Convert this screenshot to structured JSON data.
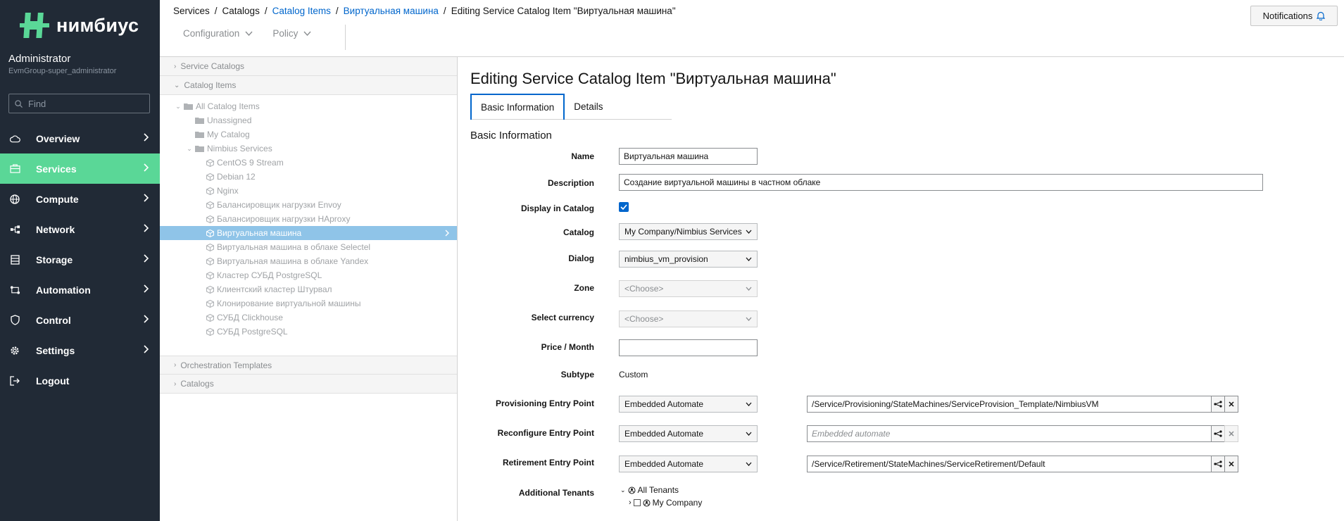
{
  "app": {
    "name": "нимбиус",
    "brand_color": "#5ad797",
    "sidebar_bg": "#212a36",
    "link_color": "#0066cc"
  },
  "user": {
    "name": "Administrator",
    "group": "EvmGroup-super_administrator"
  },
  "search": {
    "placeholder": "Find"
  },
  "nav": [
    {
      "label": "Overview",
      "icon": "cloud-icon",
      "active": false
    },
    {
      "label": "Services",
      "icon": "box-icon",
      "active": true
    },
    {
      "label": "Compute",
      "icon": "globe-icon",
      "active": false
    },
    {
      "label": "Network",
      "icon": "network-icon",
      "active": false
    },
    {
      "label": "Storage",
      "icon": "database-icon",
      "active": false
    },
    {
      "label": "Automation",
      "icon": "automation-icon",
      "active": false
    },
    {
      "label": "Control",
      "icon": "shield-icon",
      "active": false
    },
    {
      "label": "Settings",
      "icon": "gear-icon",
      "active": false
    },
    {
      "label": "Logout",
      "icon": "logout-icon",
      "active": false
    }
  ],
  "breadcrumb": {
    "items": [
      "Services",
      "Catalogs",
      "Catalog Items",
      "Виртуальная машина",
      "Editing Service Catalog Item \"Виртуальная машина\""
    ],
    "separator": "/"
  },
  "toolbar": {
    "configuration": "Configuration",
    "policy": "Policy"
  },
  "notifications": {
    "label": "Notifications"
  },
  "accordion": {
    "service_catalogs": "Service Catalogs",
    "catalog_items": "Catalog Items",
    "orchestration_templates": "Orchestration Templates",
    "catalogs": "Catalogs"
  },
  "tree": {
    "root": "All Catalog Items",
    "unassigned": "Unassigned",
    "my_catalog": "My Catalog",
    "nimbius_services": "Nimbius Services",
    "items": [
      "CentOS 9 Stream",
      "Debian 12",
      "Nginx",
      "Балансировщик нагрузки Envoy",
      "Балансировщик нагрузки HAproxy",
      "Виртуальная машина",
      "Виртуальная машина в облаке Selectel",
      "Виртуальная машина в облаке Yandex",
      "Кластер СУБД PostgreSQL",
      "Клиентский кластер Штурвал",
      "Клонирование виртуальной машины",
      "СУБД Clickhouse",
      "СУБД PostgreSQL"
    ],
    "selected_index": 5
  },
  "form": {
    "title": "Editing Service Catalog Item \"Виртуальная машина\"",
    "tabs": [
      "Basic Information",
      "Details"
    ],
    "section": "Basic Information",
    "labels": {
      "name": "Name",
      "description": "Description",
      "display_in_catalog": "Display in Catalog",
      "catalog": "Catalog",
      "dialog": "Dialog",
      "zone": "Zone",
      "currency": "Select currency",
      "price": "Price / Month",
      "subtype": "Subtype",
      "provisioning": "Provisioning Entry Point",
      "reconfigure": "Reconfigure Entry Point",
      "retirement": "Retirement Entry Point",
      "tenants": "Additional Tenants"
    },
    "values": {
      "name": "Виртуальная машина",
      "description": "Создание виртуальной машины в частном облаке",
      "display_in_catalog": true,
      "catalog": "My Company/Nimbius Services",
      "dialog": "nimbius_vm_provision",
      "zone": "<Choose>",
      "currency": "<Choose>",
      "price": "",
      "subtype": "Custom",
      "provisioning_type": "Embedded Automate",
      "provisioning_path": "/Service/Provisioning/StateMachines/ServiceProvision_Template/NimbiusVM",
      "reconfigure_type": "Embedded Automate",
      "reconfigure_placeholder": "Embedded automate",
      "retirement_type": "Embedded Automate",
      "retirement_path": "/Service/Retirement/StateMachines/ServiceRetirement/Default"
    },
    "tenants": {
      "all": "All Tenants",
      "company": "My Company"
    }
  }
}
